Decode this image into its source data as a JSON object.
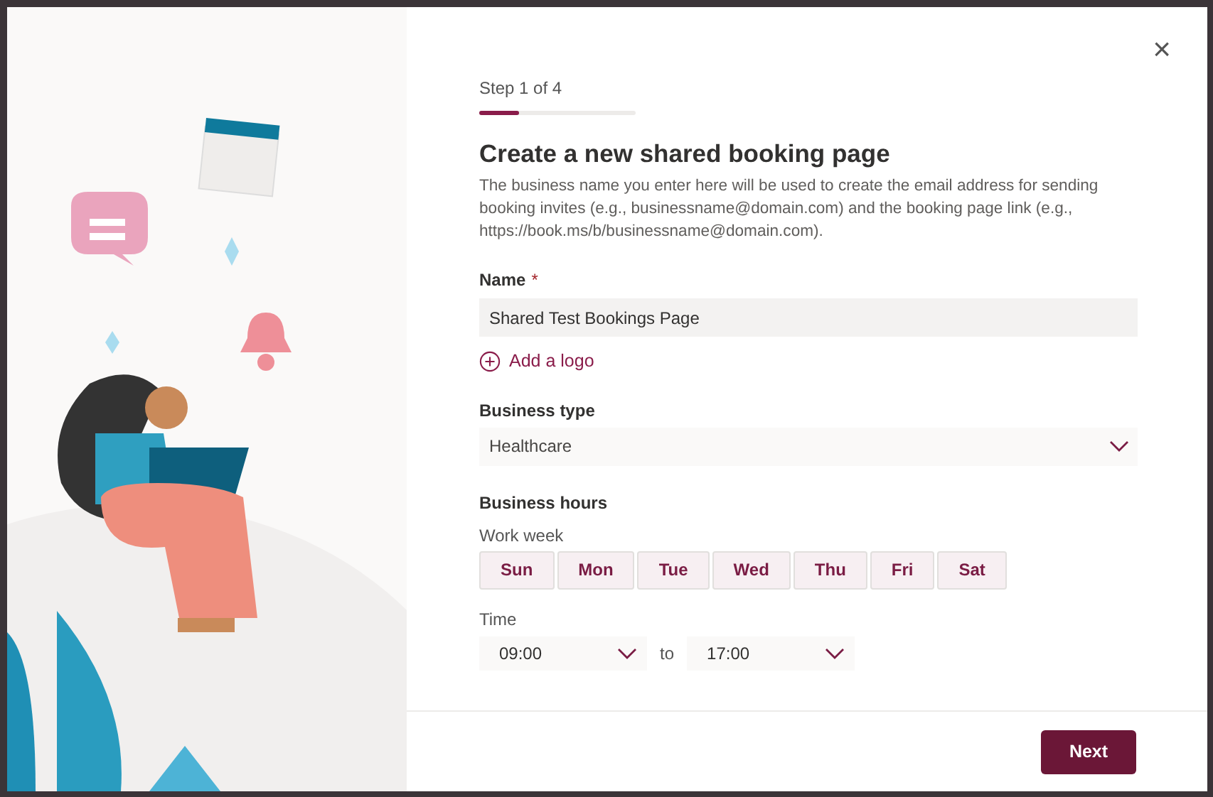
{
  "dialog": {
    "close_label": "×"
  },
  "progress": {
    "label": "Step 1 of 4",
    "level": 0.25
  },
  "title": "Create a new shared booking page",
  "description": "The business name you enter here will be used to create the email address for sending booking invites (e.g., businessname@domain.com) and the booking page link (e.g., https://book.ms/b/businessname@domain.com).",
  "name_field": {
    "label": "Name",
    "required_mark": "*",
    "value": "Shared Test Bookings Page"
  },
  "add_logo": {
    "label": "Add a logo"
  },
  "business_type": {
    "label": "Business type",
    "value": "Healthcare"
  },
  "business_hours": {
    "label": "Business hours",
    "work_week_label": "Work week",
    "days": [
      {
        "label": "Sun",
        "selected": false
      },
      {
        "label": "Mon",
        "selected": false
      },
      {
        "label": "Tue",
        "selected": false
      },
      {
        "label": "Wed",
        "selected": false
      },
      {
        "label": "Thu",
        "selected": false
      },
      {
        "label": "Fri",
        "selected": false
      },
      {
        "label": "Sat",
        "selected": false
      }
    ],
    "time_label": "Time",
    "start": "09:00",
    "separator": "to",
    "end": "17:00"
  },
  "footer": {
    "next_button": "Next"
  }
}
